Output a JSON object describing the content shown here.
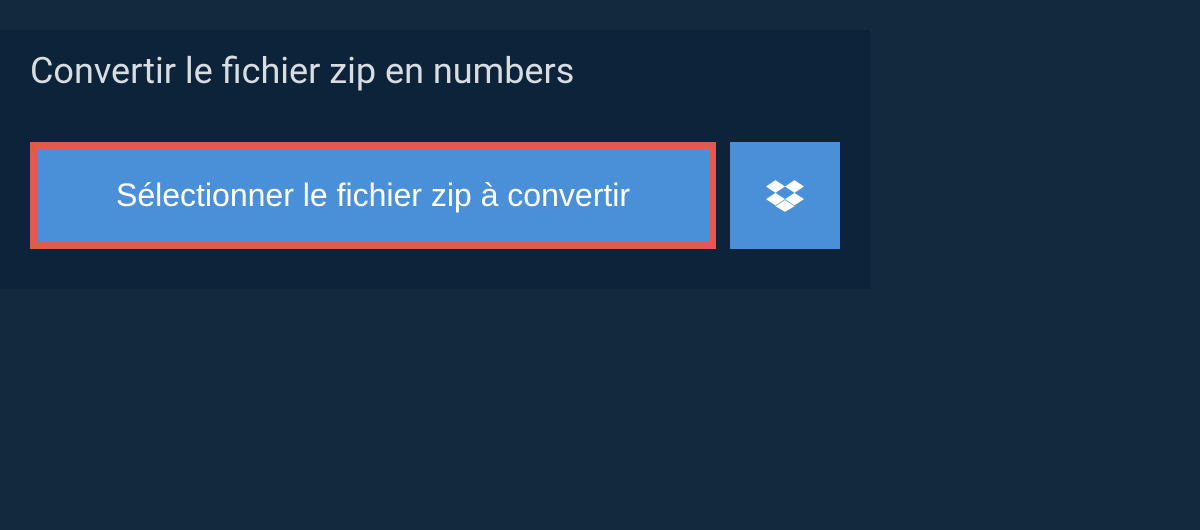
{
  "header": {
    "title": "Convertir le fichier zip en numbers"
  },
  "buttons": {
    "select_file_label": "Sélectionner le fichier zip à convertir"
  },
  "colors": {
    "background": "#13293d",
    "panel": "#0c2339",
    "button_primary": "#4a90d9",
    "highlight_border": "#e05a4f",
    "text_light": "#d8dde2",
    "text_white": "#ffffff"
  }
}
